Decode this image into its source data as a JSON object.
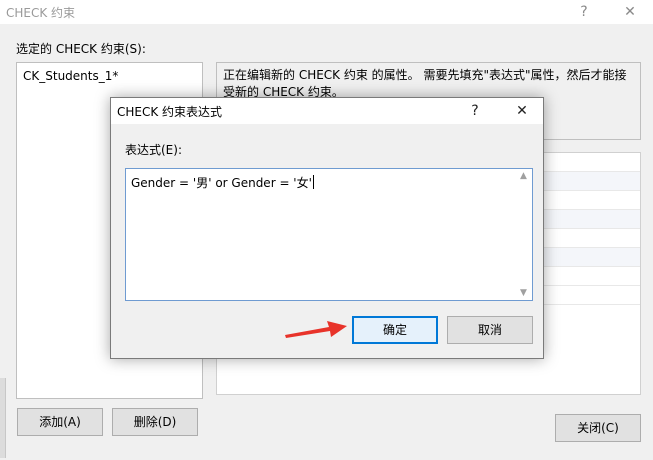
{
  "window": {
    "title": "CHECK 约束",
    "help_glyph": "?",
    "close_glyph": "✕"
  },
  "constraints": {
    "label": "选定的 CHECK 约束(S):",
    "items": [
      "CK_Students_1*"
    ]
  },
  "description": "正在编辑新的 CHECK 约束 的属性。 需要先填充\"表达式\"属性，然后才能接受新的 CHECK 约束。",
  "buttons": {
    "add": "添加(A)",
    "delete": "删除(D)",
    "close": "关闭(C)"
  },
  "dialog": {
    "title": "CHECK 约束表达式",
    "help_glyph": "?",
    "close_glyph": "✕",
    "expression_label": "表达式(E):",
    "expression_value": "Gender = '男' or Gender = '女'",
    "ok": "确定",
    "cancel": "取消"
  },
  "colors": {
    "accent": "#0078d7",
    "arrow": "#e8332a"
  }
}
